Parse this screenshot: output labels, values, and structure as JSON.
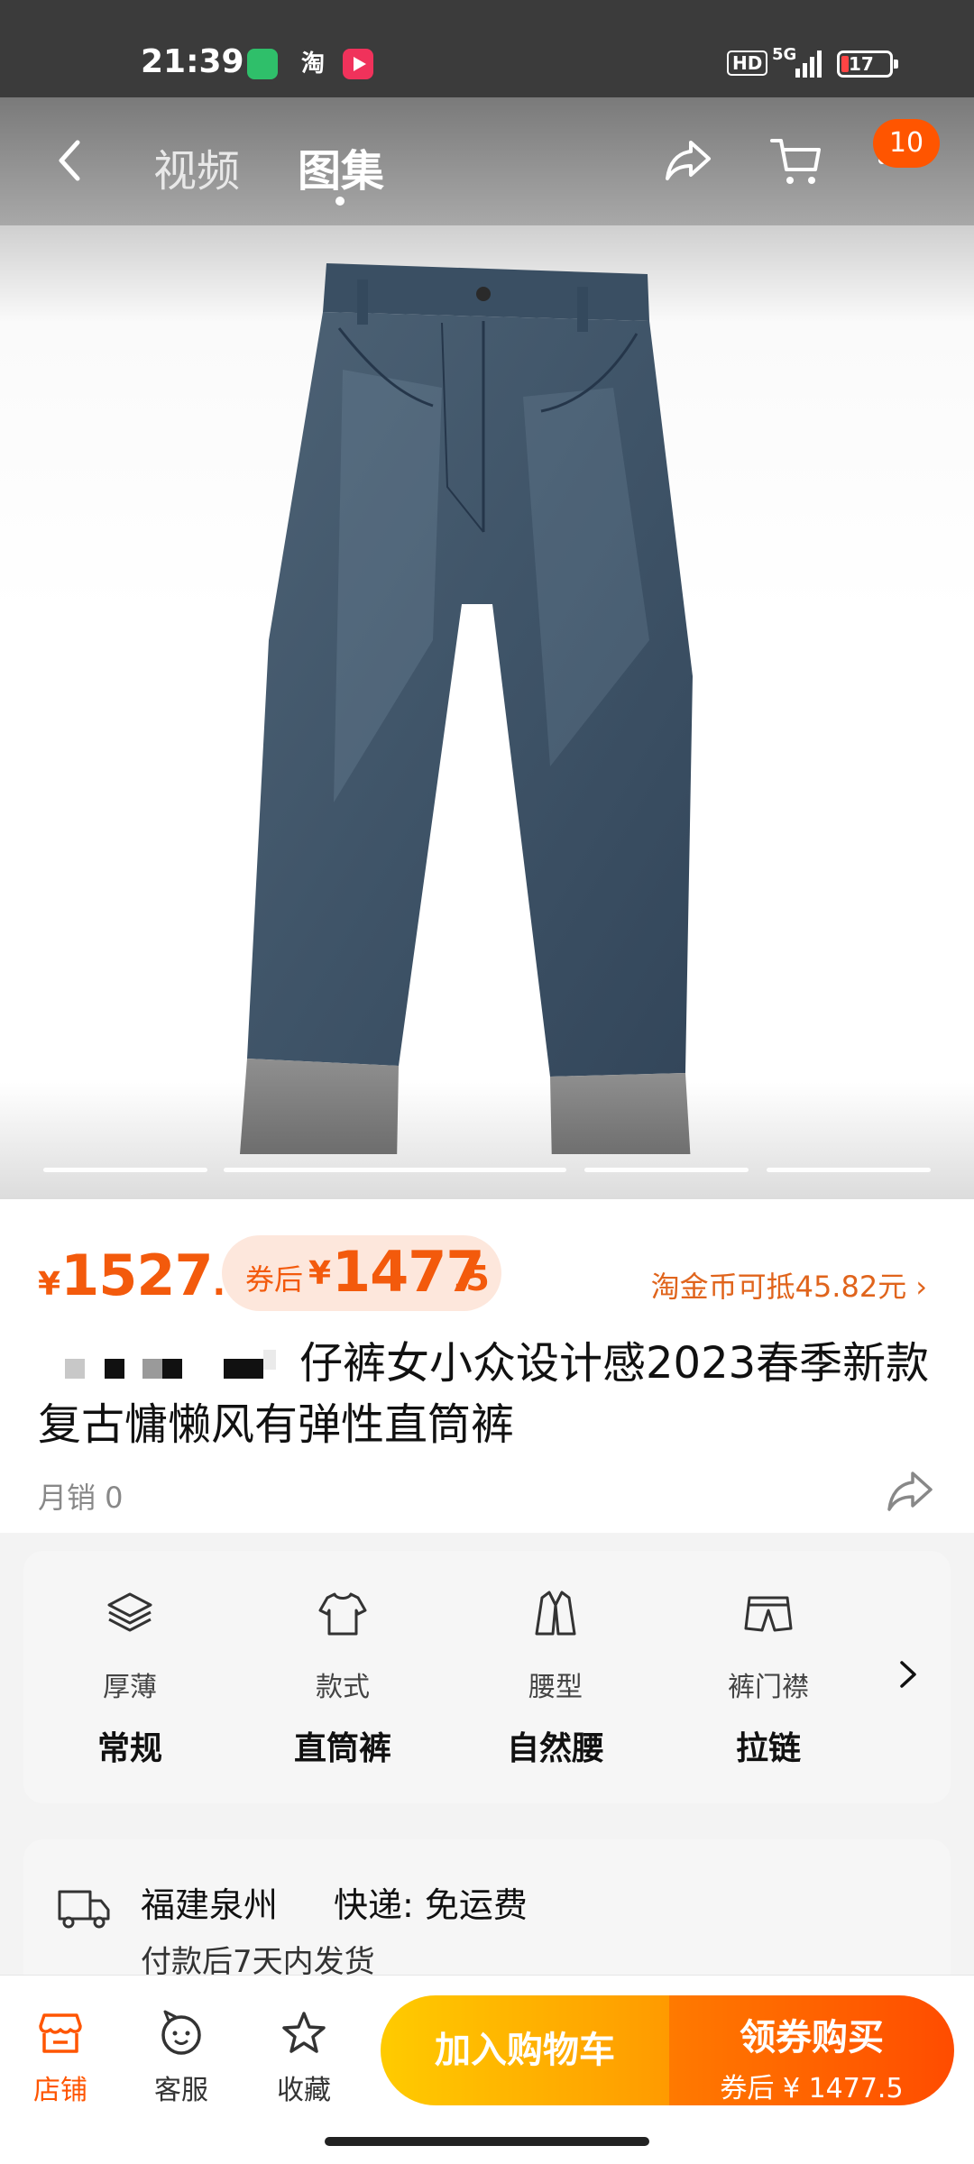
{
  "status_bar": {
    "time": "21:39",
    "taobao_glyph": "淘",
    "hd": "HD",
    "network": "5G",
    "battery": "17"
  },
  "nav": {
    "tabs": [
      {
        "label": "视频"
      },
      {
        "label": "图集"
      }
    ],
    "cart_badge": "10"
  },
  "product": {
    "price": {
      "currency": "¥",
      "integer": "1527",
      "decimal": ".5"
    },
    "coupon_price": {
      "label": "券后",
      "currency": "¥",
      "integer": "1477",
      "decimal": ".5"
    },
    "coin_offset": "淘金币可抵45.82元",
    "title_visible": "仔裤女小众设计感2023春季新款复古慵懒风有弹性直筒裤",
    "monthly_sales": "月销 0",
    "image_count": 4
  },
  "attributes": [
    {
      "icon": "layers-icon",
      "label": "厚薄",
      "value": "常规"
    },
    {
      "icon": "shirt-icon",
      "label": "款式",
      "value": "直筒裤"
    },
    {
      "icon": "jacket-icon",
      "label": "腰型",
      "value": "自然腰"
    },
    {
      "icon": "pants-icon",
      "label": "裤门襟",
      "value": "拉链"
    }
  ],
  "shipping": {
    "origin": "福建泉州",
    "express": "快递: 免运费",
    "eta": "付款后7天内发货"
  },
  "bottom_bar": {
    "store": "店铺",
    "service": "客服",
    "favorite": "收藏",
    "add_to_cart": "加入购物车",
    "buy_label": "领券购买",
    "buy_price": "券后 ¥ 1477.5"
  },
  "colors": {
    "accent": "#ff5500",
    "price": "#f35a0c",
    "cart_button": "#ffb000",
    "buy_button": "#ff5a00"
  }
}
